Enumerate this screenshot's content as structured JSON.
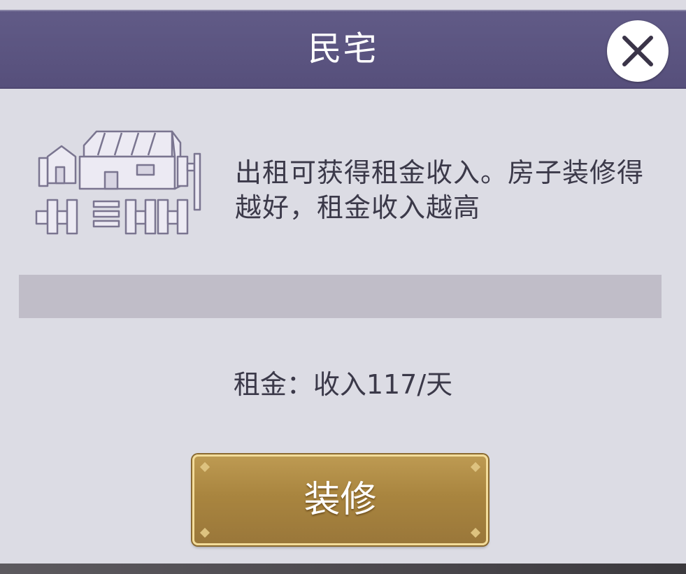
{
  "dialog": {
    "title": "民宅",
    "close_icon": "close-icon",
    "building_icon": "house-icon",
    "description": "出租可获得租金收入。房子装修得越好，租金收入越高",
    "rent_text": "租金：收入117/天",
    "renovate_label": "装修"
  },
  "colors": {
    "header": "#5a5380",
    "panel": "#dcdce4",
    "bar": "#c0bdc8",
    "button_gold": "#a9853f",
    "text": "#3b3949"
  }
}
